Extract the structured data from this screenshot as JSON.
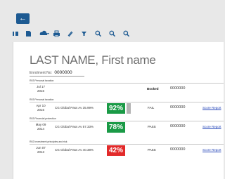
{
  "nav": {
    "back_glyph": "←"
  },
  "toolbar": {
    "icons": [
      "sidebar-toggle-icon",
      "document-icon",
      "cloud-download-icon",
      "print-icon",
      "attachment-icon",
      "filter-icon",
      "search-icon",
      "zoom-out-icon",
      "zoom-in-icon"
    ]
  },
  "header": {
    "title": "LAST NAME, First name",
    "enrolment_label": "Enrolment No:",
    "enrolment_value": "0000000"
  },
  "sections": [
    {
      "heading": "R03 Personal taxation",
      "rows": [
        {
          "date_line1": "Jul 17",
          "date_line2": "2016",
          "name": "",
          "score": "",
          "status": "Booked",
          "number": "0000000",
          "report": ""
        }
      ]
    },
    {
      "heading": "R03 Personal taxation",
      "rows": [
        {
          "date_line1": "Apr 10",
          "date_line2": "2016",
          "name": "CG Global Pass Av 35.99%",
          "score": "92%",
          "score_color": "green",
          "status": "FAIL",
          "number": "0000000",
          "report": "Score Report"
        }
      ]
    },
    {
      "heading": "R03 Financial protection",
      "rows": [
        {
          "date_line1": "May 09",
          "date_line2": "2014",
          "name": "CG Global Pass Av 57.33%",
          "score": "78%",
          "score_color": "green",
          "status": "PASS",
          "number": "0000000",
          "report": "Score Report"
        }
      ]
    },
    {
      "heading": "R02 Investment principles and risk",
      "rows": [
        {
          "date_line1": "Jun 07",
          "date_line2": "2013",
          "name": "CG Global Pass Av 40.38%",
          "score": "42%",
          "score_color": "red",
          "status": "PASS",
          "number": "0000000",
          "report": "Score Report"
        }
      ]
    }
  ]
}
